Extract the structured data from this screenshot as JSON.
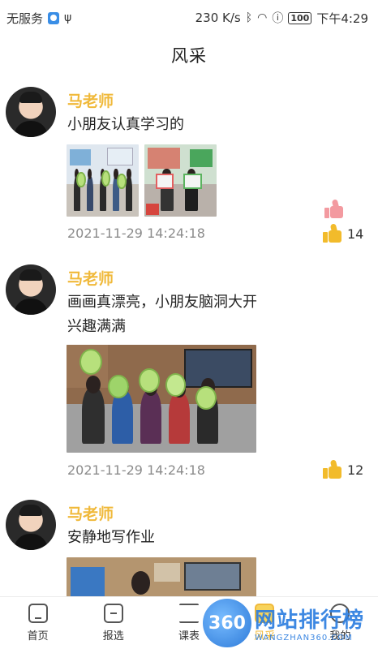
{
  "status_bar": {
    "carrier": "无服务",
    "network_speed": "230 K/s",
    "battery": "100",
    "time": "下午4:29"
  },
  "header": {
    "title": "风采"
  },
  "posts": [
    {
      "author": "马老师",
      "content": "小朋友认真学习的",
      "timestamp": "2021-11-29 14:24:18",
      "like_count": "14",
      "photos": 2
    },
    {
      "author": "马老师",
      "content": "画画真漂亮，小朋友脑洞大开兴趣满满",
      "timestamp": "2021-11-29 14:24:18",
      "like_count": "12",
      "photos": 1
    },
    {
      "author": "马老师",
      "content": "安静地写作业",
      "photos": 1
    }
  ],
  "tab_bar": {
    "tabs": [
      {
        "label": "首页",
        "icon": "home-icon"
      },
      {
        "label": "报选",
        "icon": "report-icon"
      },
      {
        "label": "课表",
        "icon": "schedule-icon"
      },
      {
        "label": "风采",
        "icon": "showcase-icon",
        "active": true
      },
      {
        "label": "我的",
        "icon": "profile-icon"
      }
    ]
  },
  "watermark": {
    "logo_text": "360",
    "title": "网站排行榜",
    "subtitle": "WANGZHAN360.COM"
  },
  "colors": {
    "accent": "#f0b93a",
    "timestamp": "#8c8c8c",
    "like_pink": "#f39aa0"
  }
}
